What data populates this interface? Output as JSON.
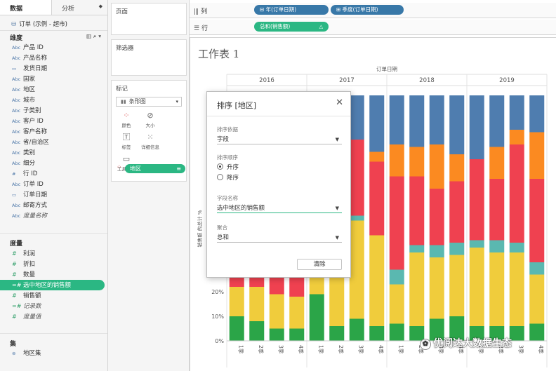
{
  "data_pane": {
    "tab_data": "数据",
    "tab_analysis": "分析",
    "datasource": "订单 (示例 - 超市)",
    "dimensions_title": "维度",
    "dimensions": [
      {
        "type": "Abc",
        "name": "产品 ID"
      },
      {
        "type": "Abc",
        "name": "产品名称"
      },
      {
        "type": "date",
        "name": "发货日期"
      },
      {
        "type": "Abc",
        "name": "国家"
      },
      {
        "type": "Abc",
        "name": "地区"
      },
      {
        "type": "Abc",
        "name": "城市"
      },
      {
        "type": "Abc",
        "name": "子类别"
      },
      {
        "type": "Abc",
        "name": "客户 ID"
      },
      {
        "type": "Abc",
        "name": "客户名称"
      },
      {
        "type": "Abc",
        "name": "省/自治区"
      },
      {
        "type": "Abc",
        "name": "类别"
      },
      {
        "type": "Abc",
        "name": "细分"
      },
      {
        "type": "#",
        "name": "行 ID"
      },
      {
        "type": "Abc",
        "name": "订单 ID"
      },
      {
        "type": "date",
        "name": "订单日期"
      },
      {
        "type": "Abc",
        "name": "邮寄方式"
      },
      {
        "type": "Abc",
        "name": "度量名称"
      }
    ],
    "measures_title": "度量",
    "measures": [
      {
        "type": "#",
        "name": "利润"
      },
      {
        "type": "#",
        "name": "折扣"
      },
      {
        "type": "#",
        "name": "数量"
      },
      {
        "type": "=#",
        "name": "选中地区的销售额"
      },
      {
        "type": "#",
        "name": "销售额"
      },
      {
        "type": "=#",
        "name": "记录数"
      },
      {
        "type": "#",
        "name": "度量值"
      }
    ],
    "sets_title": "集",
    "sets": [
      {
        "name": "地区集"
      }
    ]
  },
  "cards": {
    "pages_title": "页面",
    "filters_title": "筛选器",
    "marks_title": "标记",
    "mark_type": "条形图",
    "mark_buttons": [
      {
        "icon": "color-dots-icon",
        "label": "颜色"
      },
      {
        "icon": "size-icon",
        "label": "大小"
      },
      {
        "icon": "label-icon",
        "label": "标签"
      },
      {
        "icon": "detail-icon",
        "label": "详细信息"
      },
      {
        "icon": "tooltip-icon",
        "label": "工具提示"
      }
    ],
    "color_field": "地区"
  },
  "shelves": {
    "columns_label": "列",
    "rows_label": "行",
    "column_pills": [
      "年(订单日期)",
      "季度(订单日期)"
    ],
    "row_pill": "总和(销售额)"
  },
  "sheet": {
    "title": "工作表 1"
  },
  "chart_data": {
    "type": "bar",
    "stacked": true,
    "title": "",
    "x_header": "订单日期",
    "years": [
      "2016",
      "2017",
      "2018",
      "2019"
    ],
    "quarter_labels": [
      "1季",
      "2季",
      "3季",
      "4季"
    ],
    "ylabel": "销售额 的总计 %",
    "ylim": [
      0,
      100
    ],
    "y_ticks": [
      "0%",
      "10%",
      "20%"
    ],
    "y_tick_values": [
      0,
      10,
      20
    ],
    "legend": "none",
    "series": [
      {
        "name": "green",
        "color": "#2ba548",
        "values": [
          10,
          8,
          5,
          5,
          19,
          6,
          9,
          6,
          7,
          6,
          9,
          10,
          6,
          6,
          6,
          7
        ]
      },
      {
        "name": "yellow",
        "color": "#f0cc3c",
        "values": [
          12,
          14,
          14,
          13,
          15,
          23,
          40,
          37,
          16,
          30,
          25,
          25,
          32,
          30,
          30,
          20
        ]
      },
      {
        "name": "teal",
        "color": "#5ab8b0",
        "values": [
          0,
          0,
          0,
          0,
          0,
          2,
          2,
          0,
          6,
          3,
          5,
          5,
          3,
          5,
          4,
          5
        ]
      },
      {
        "name": "red",
        "color": "#ef4150",
        "values": [
          28,
          28,
          16,
          25,
          24,
          32,
          31,
          30,
          38,
          28,
          23,
          25,
          33,
          25,
          40,
          34
        ]
      },
      {
        "name": "orange",
        "color": "#fb8a21",
        "values": [
          23,
          26,
          36,
          31,
          19,
          12,
          0,
          4,
          13,
          12,
          18,
          11,
          0,
          13,
          6,
          19
        ]
      },
      {
        "name": "blue",
        "color": "#4f7daf",
        "values": [
          27,
          24,
          29,
          26,
          23,
          25,
          18,
          23,
          20,
          21,
          20,
          24,
          26,
          21,
          14,
          15
        ]
      }
    ]
  },
  "sort_dialog": {
    "title": "排序 [地区]",
    "sort_by_label": "排序依据",
    "sort_by_value": "字段",
    "order_label": "排序顺序",
    "order_options": [
      "升序",
      "降序"
    ],
    "order_selected": 0,
    "field_label": "字段名称",
    "field_value": "选中地区的销售额",
    "aggregation_label": "聚合",
    "aggregation_value": "总和",
    "clear_button": "清除"
  },
  "watermark": "优阅达大数据生态"
}
